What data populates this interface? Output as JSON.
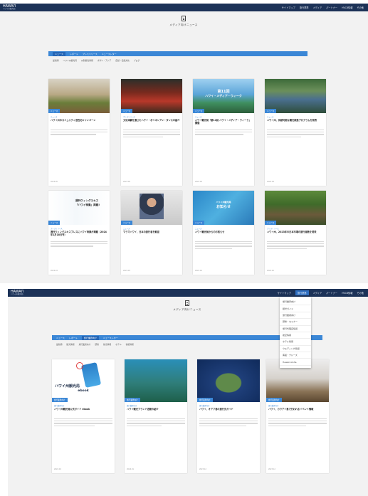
{
  "brand": {
    "logo": "HAWAI'I",
    "logo_sub": "ハワイ州観光局"
  },
  "topnav": [
    "サイトマップ",
    "旅行業界",
    "メディア",
    "パートナー",
    "HVCB情報",
    "その他"
  ],
  "page_title": "メディア向けニュース",
  "top_panel": {
    "tabs": [
      "ニュース",
      "レポート",
      "プレスリリース",
      "ニュースレター"
    ],
    "subtabs": [
      "最新順",
      "ハワイ州観光局",
      "州別観光情報",
      "ポポヘ・アジア",
      "自然・伝統文化",
      "ブログ"
    ],
    "cards": [
      {
        "tag": "ニュース",
        "meta": "ニュース",
        "title": "ハワイ州のコミュニティ活性化キャンペーン",
        "date": "2024.05"
      },
      {
        "tag": "ニュース",
        "meta": "プレスリリース",
        "title": "文化体験を通じたハワイ・ポリネシアン・ダンスの紹介",
        "date": "2024.05"
      },
      {
        "tag": "ニュース",
        "meta": "ニュース",
        "title": "ハワイ観光局「第11回 ハワイ・メディア・ウィーク」開催",
        "date": "2024.04",
        "thumb_line1": "第11回",
        "thumb_line2": "ハワイ・メディア・ウィーク"
      },
      {
        "tag": "ニュース",
        "meta": "ニュース",
        "title": "ハワイ州、持続可能な観光推進プログラムを発表",
        "date": "2024.04"
      },
      {
        "tag": "ニュース",
        "meta": "プレスリリース",
        "title": "週刊ウィングエキスプレスにハワイ特集が掲載（2024年1月18日号）",
        "date": "2024.03",
        "thumb_line1": "週刊ウィングエキス",
        "thumb_line2": "「ハワイ特集」掲載!"
      },
      {
        "tag": "ニュース",
        "meta": "ニュース",
        "title": "マラマハワイ、日本の旅行者を歓迎",
        "date": "2024.03"
      },
      {
        "tag": "ニュース",
        "meta": "ニュース",
        "title": "ハワイ観光局からのお知らせ",
        "date": "2024.02",
        "thumb_line1": "ハワイ州観光局",
        "thumb_line2": "お知らせ"
      },
      {
        "tag": "ニュース",
        "meta": "プレスリリース",
        "title": "ハワイ州、2023年の日本市場の旅行者数を発表",
        "date": "2024.02"
      }
    ]
  },
  "bottom_panel": {
    "tabs": [
      "ニュース",
      "レポート",
      "旅行業界向け",
      "ニュースレター"
    ],
    "subtabs": [
      "最新順",
      "観光情報",
      "旅行業者向け",
      "研修",
      "航空情報",
      "ホテル",
      "客船情報"
    ],
    "cards": [
      {
        "tag": "旅行業界向け",
        "meta": "旅行業界向け",
        "title": "ハワイ州観光局公式ガイド ebook",
        "date": "2024.01",
        "thumb_line1": "ハワイ州観光局",
        "thumb_line2": "ebook"
      },
      {
        "tag": "旅行業界向け",
        "meta": "旅行業界向け",
        "title": "ハワイ観光ブランド活動の紹介",
        "date": "2024.01"
      },
      {
        "tag": "旅行業界向け",
        "meta": "旅行業界向け",
        "title": "ハワイ、オアフ島の旅行先ガイド",
        "date": "2023.12"
      },
      {
        "tag": "旅行業界向け",
        "meta": "旅行業界向け",
        "title": "ハワイ、カウアイ島で行われるイベント情報",
        "date": "2023.12"
      }
    ]
  },
  "dropdown": [
    "旅行業界向け",
    "観光ガイド",
    "旅行業者向け",
    "研修・セミナー",
    "旅行代理店情報",
    "航空情報",
    "ホテル情報",
    "ウエディング情報",
    "客船・クルーズ",
    "Hawaii Aloha"
  ],
  "colors": {
    "navy": "#1c3257",
    "accent": "#3b87d6"
  }
}
